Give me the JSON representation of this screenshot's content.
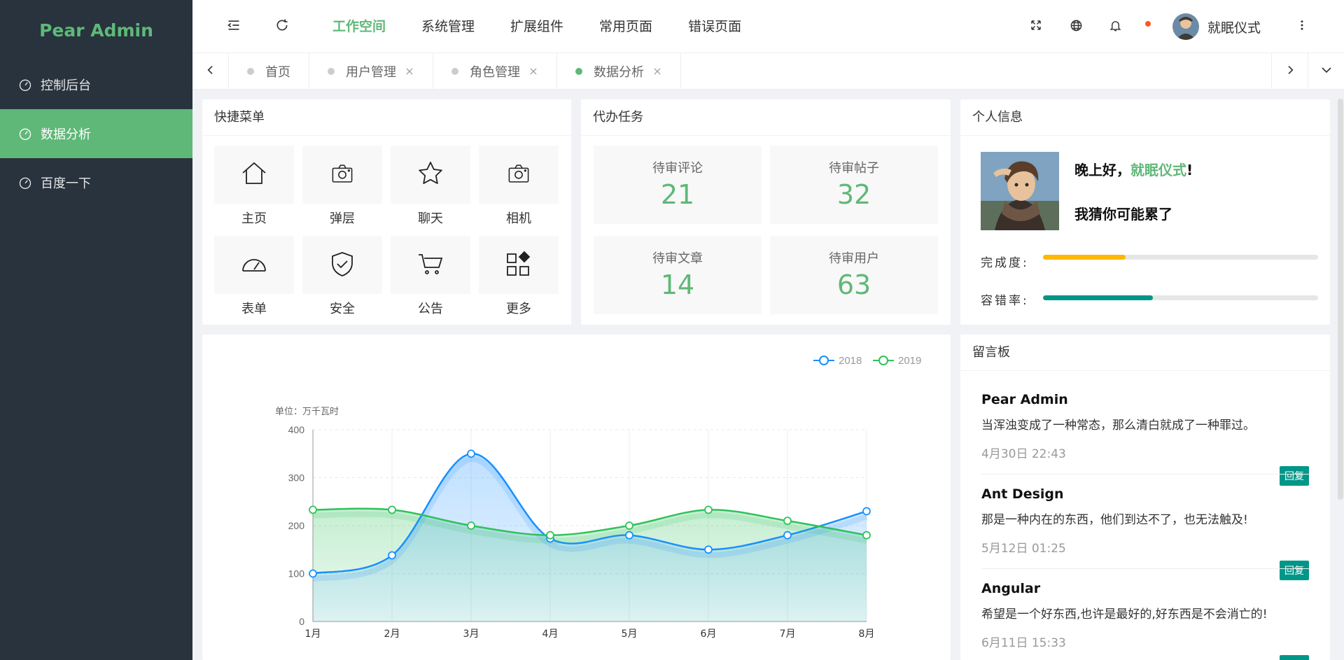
{
  "app": {
    "logo": "Pear Admin"
  },
  "sidebar": {
    "items": [
      {
        "label": "控制后台"
      },
      {
        "label": "数据分析"
      },
      {
        "label": "百度一下"
      }
    ]
  },
  "header": {
    "nav": [
      {
        "label": "工作空间"
      },
      {
        "label": "系统管理"
      },
      {
        "label": "扩展组件"
      },
      {
        "label": "常用页面"
      },
      {
        "label": "错误页面"
      }
    ],
    "user_name": "就眠仪式"
  },
  "tabs": [
    {
      "label": "首页"
    },
    {
      "label": "用户管理"
    },
    {
      "label": "角色管理"
    },
    {
      "label": "数据分析"
    }
  ],
  "quick_menu": {
    "title": "快捷菜单",
    "items": [
      {
        "label": "主页",
        "icon": "home-icon"
      },
      {
        "label": "弹层",
        "icon": "camera-icon"
      },
      {
        "label": "聊天",
        "icon": "star-icon"
      },
      {
        "label": "相机",
        "icon": "camera-icon"
      },
      {
        "label": "表单",
        "icon": "gauge-icon"
      },
      {
        "label": "安全",
        "icon": "shield-icon"
      },
      {
        "label": "公告",
        "icon": "cart-icon"
      },
      {
        "label": "更多",
        "icon": "apps-icon"
      }
    ]
  },
  "todo": {
    "title": "代办任务",
    "items": [
      {
        "label": "待审评论",
        "value": "21"
      },
      {
        "label": "待审帖子",
        "value": "32"
      },
      {
        "label": "待审文章",
        "value": "14"
      },
      {
        "label": "待审用户",
        "value": "63"
      }
    ]
  },
  "profile": {
    "title": "个人信息",
    "greeting_prefix": "晚上好，",
    "greeting_name": "就眠仪式",
    "greeting_suffix": "!",
    "subtext": "我猜你可能累了",
    "progress": [
      {
        "label": "完成度:",
        "value": 0.3,
        "color": "#ffb800"
      },
      {
        "label": "容错率:",
        "value": 0.4,
        "color": "#009688"
      }
    ]
  },
  "messages": {
    "title": "留言板",
    "reply_label": "回复",
    "items": [
      {
        "author": "Pear Admin",
        "text": "当浑浊变成了一种常态，那么清白就成了一种罪过。",
        "time": "4月30日 22:43"
      },
      {
        "author": "Ant Design",
        "text": "那是一种内在的东西，他们到达不了，也无法触及!",
        "time": "5月12日 01:25"
      },
      {
        "author": "Angular",
        "text": "希望是一个好东西,也许是最好的,好东西是不会消亡的!",
        "time": "6月11日 15:33"
      }
    ]
  },
  "chart_data": {
    "type": "line",
    "smooth": true,
    "area": true,
    "unit_label": "单位：万千瓦时",
    "categories": [
      "1月",
      "2月",
      "3月",
      "4月",
      "5月",
      "6月",
      "7月",
      "8月"
    ],
    "ylim": [
      0,
      400
    ],
    "yticks": [
      "0",
      "100",
      "200",
      "300",
      "400"
    ],
    "legend_position": "top-right",
    "series": [
      {
        "name": "2018",
        "values": [
          100,
          138,
          350,
          173,
          180,
          150,
          180,
          230
        ],
        "color": "#1890ff"
      },
      {
        "name": "2019",
        "values": [
          233,
          233,
          200,
          180,
          200,
          233,
          210,
          180
        ],
        "color": "#2fc25b"
      }
    ]
  }
}
